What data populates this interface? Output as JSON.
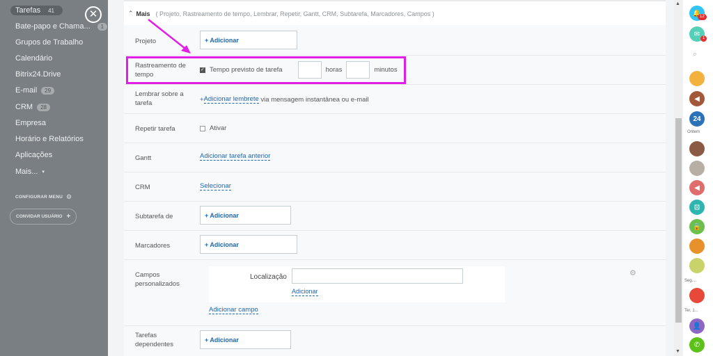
{
  "sidebar": {
    "items": [
      {
        "label": "Tarefas",
        "count": "41"
      },
      {
        "label": "Bate-papo e Chama...",
        "count": "1"
      },
      {
        "label": "Grupos de Trabalho",
        "count": ""
      },
      {
        "label": "Calendário",
        "count": ""
      },
      {
        "label": "Bitrix24.Drive",
        "count": ""
      },
      {
        "label": "E-mail",
        "count": "29"
      },
      {
        "label": "CRM",
        "count": "28"
      },
      {
        "label": "Empresa",
        "count": ""
      },
      {
        "label": "Horário e Relatórios",
        "count": ""
      },
      {
        "label": "Aplicações",
        "count": ""
      },
      {
        "label": "Mais...",
        "count": ""
      }
    ],
    "configure_menu": "CONFIGURAR MENU",
    "invite_user": "CONVIDAR USUÁRIO"
  },
  "more": {
    "title": "Mais",
    "options": "( Projeto,  Rastreamento de tempo,  Lembrar,  Repetir,  Gantt,  CRM,  Subtarefa,  Marcadores,  Campos )"
  },
  "fields": {
    "project": {
      "label": "Projeto",
      "button": "+ Adicionar"
    },
    "time_tracking": {
      "label": "Rastreamento de tempo",
      "checkbox_label": "Tempo previsto de tarefa",
      "hours": "horas",
      "minutes": "minutos"
    },
    "reminder": {
      "label": "Lembrar sobre a tarefa",
      "link_prefix": "+ ",
      "link": "Adicionar lembrete",
      "suffix": " via mensagem instantânea ou e-mail"
    },
    "repeat": {
      "label": "Repetir tarefa",
      "checkbox_label": "Ativar"
    },
    "gantt": {
      "label": "Gantt",
      "link": "Adicionar tarefa anterior"
    },
    "crm": {
      "label": "CRM",
      "link": "Selecionar"
    },
    "subtask": {
      "label": "Subtarefa de",
      "button": "+ Adicionar"
    },
    "tags": {
      "label": "Marcadores",
      "button": "+ Adicionar"
    },
    "custom_fields": {
      "label": "Campos personalizados",
      "location_label": "Localização",
      "location_link": "Adicionar",
      "add_field": "Adicionar campo"
    },
    "dependent": {
      "label": "Tarefas dependentes",
      "button": "+ Adicionar"
    }
  },
  "rightbar": {
    "notif_count": "12",
    "chat_count": "1",
    "logo_text": "24",
    "label_yesterday": "Ontem",
    "label_seg": "Seg....",
    "label_ter": "Ter, 1..."
  },
  "colors": {
    "highlight": "#e11ee6",
    "link": "#2067b0",
    "sidebar": "#797f83"
  }
}
